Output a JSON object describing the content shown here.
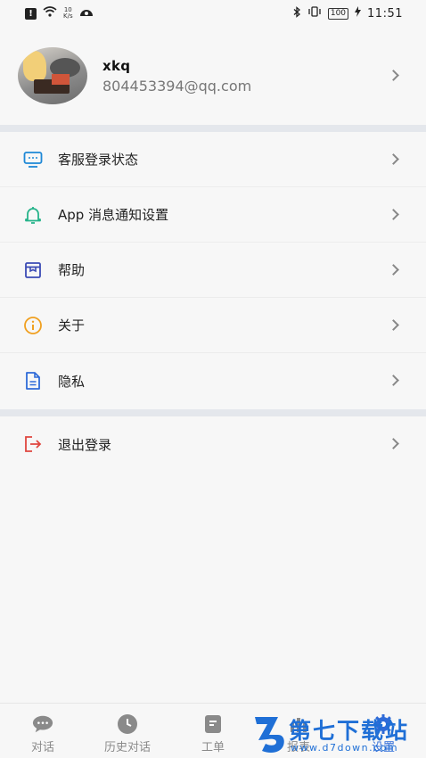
{
  "status_bar": {
    "net_speed": "10",
    "net_unit": "K/s",
    "battery": "100",
    "time": "11:51"
  },
  "profile": {
    "username": "xkq",
    "email": "804453394@qq.com"
  },
  "menu_group_1": [
    {
      "label": "客服登录状态",
      "icon": "monitor-icon"
    },
    {
      "label": "App 消息通知设置",
      "icon": "bell-icon"
    },
    {
      "label": "帮助",
      "icon": "help-box-icon"
    },
    {
      "label": "关于",
      "icon": "info-icon"
    },
    {
      "label": "隐私",
      "icon": "document-icon"
    }
  ],
  "menu_group_2": [
    {
      "label": "退出登录",
      "icon": "logout-icon"
    }
  ],
  "tabs": [
    {
      "label": "对话",
      "icon": "chat-icon"
    },
    {
      "label": "历史对话",
      "icon": "clock-icon"
    },
    {
      "label": "工单",
      "icon": "ticket-icon"
    },
    {
      "label": "报表",
      "icon": "report-icon"
    },
    {
      "label": "设置",
      "icon": "settings-icon",
      "active": true
    }
  ],
  "watermark": {
    "title": "第七下载站",
    "url": "www.d7down.com"
  },
  "colors": {
    "accent": "#2f6bd8",
    "monitor": "#1e88d6",
    "bell": "#26b38a",
    "help": "#3b4bb5",
    "info": "#f0a020",
    "document": "#2f6bd8",
    "logout": "#e0463f"
  }
}
